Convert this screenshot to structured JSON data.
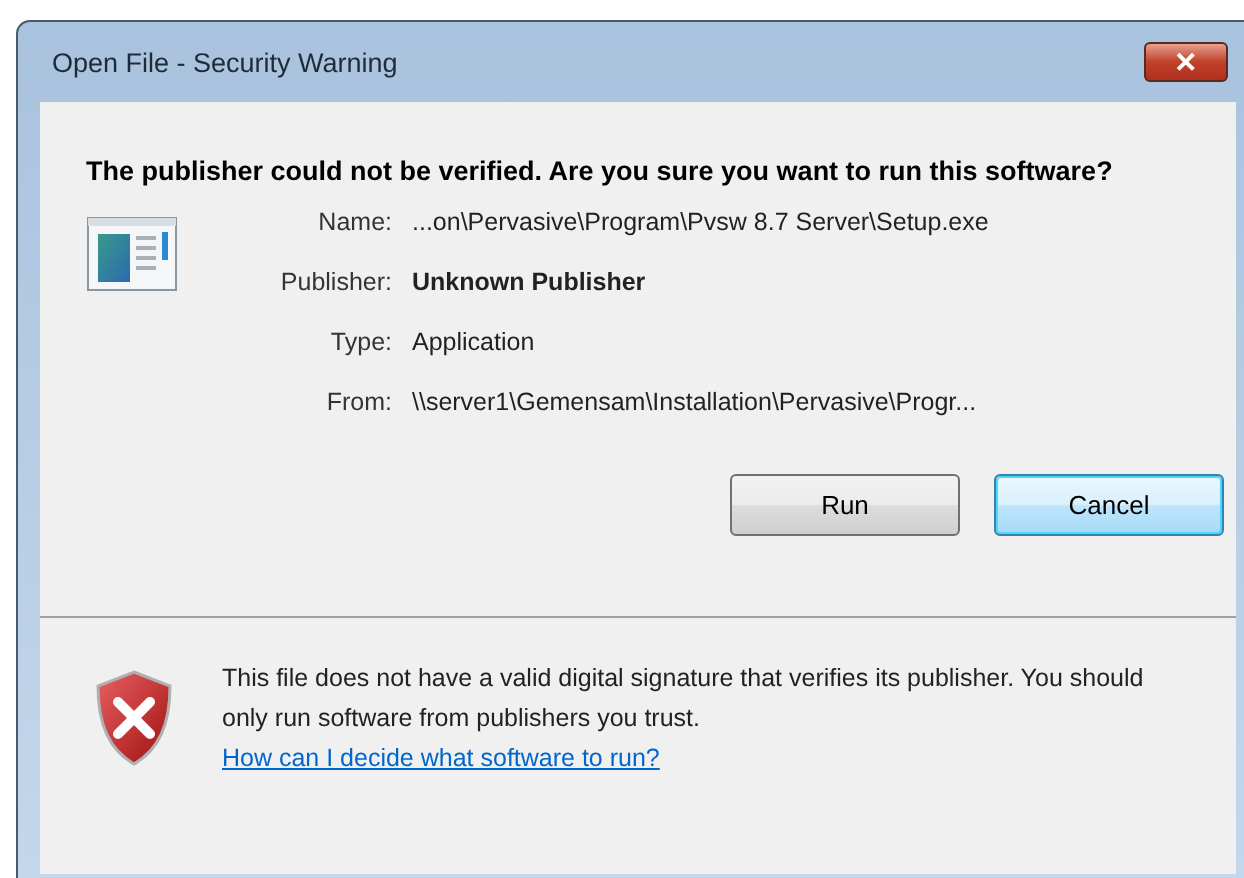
{
  "window": {
    "title": "Open File - Security Warning",
    "close": "✕"
  },
  "heading": "The publisher could not be verified.  Are you sure you want to run this software?",
  "details": [
    {
      "label": "Name:",
      "value": "...on\\Pervasive\\Program\\Pvsw 8.7 Server\\Setup.exe",
      "bold": false
    },
    {
      "label": "Publisher:",
      "value": "Unknown Publisher",
      "bold": true
    },
    {
      "label": "Type:",
      "value": "Application",
      "bold": false
    },
    {
      "label": "From:",
      "value": "\\\\server1\\Gemensam\\Installation\\Pervasive\\Progr...",
      "bold": false
    }
  ],
  "buttons": [
    {
      "label": "Run",
      "default": false
    },
    {
      "label": "Cancel",
      "default": true
    }
  ],
  "warning": {
    "text": "This file does not have a valid digital signature that verifies its publisher.  You should only run software from publishers you trust.",
    "link": "How can I decide what software to run?"
  }
}
